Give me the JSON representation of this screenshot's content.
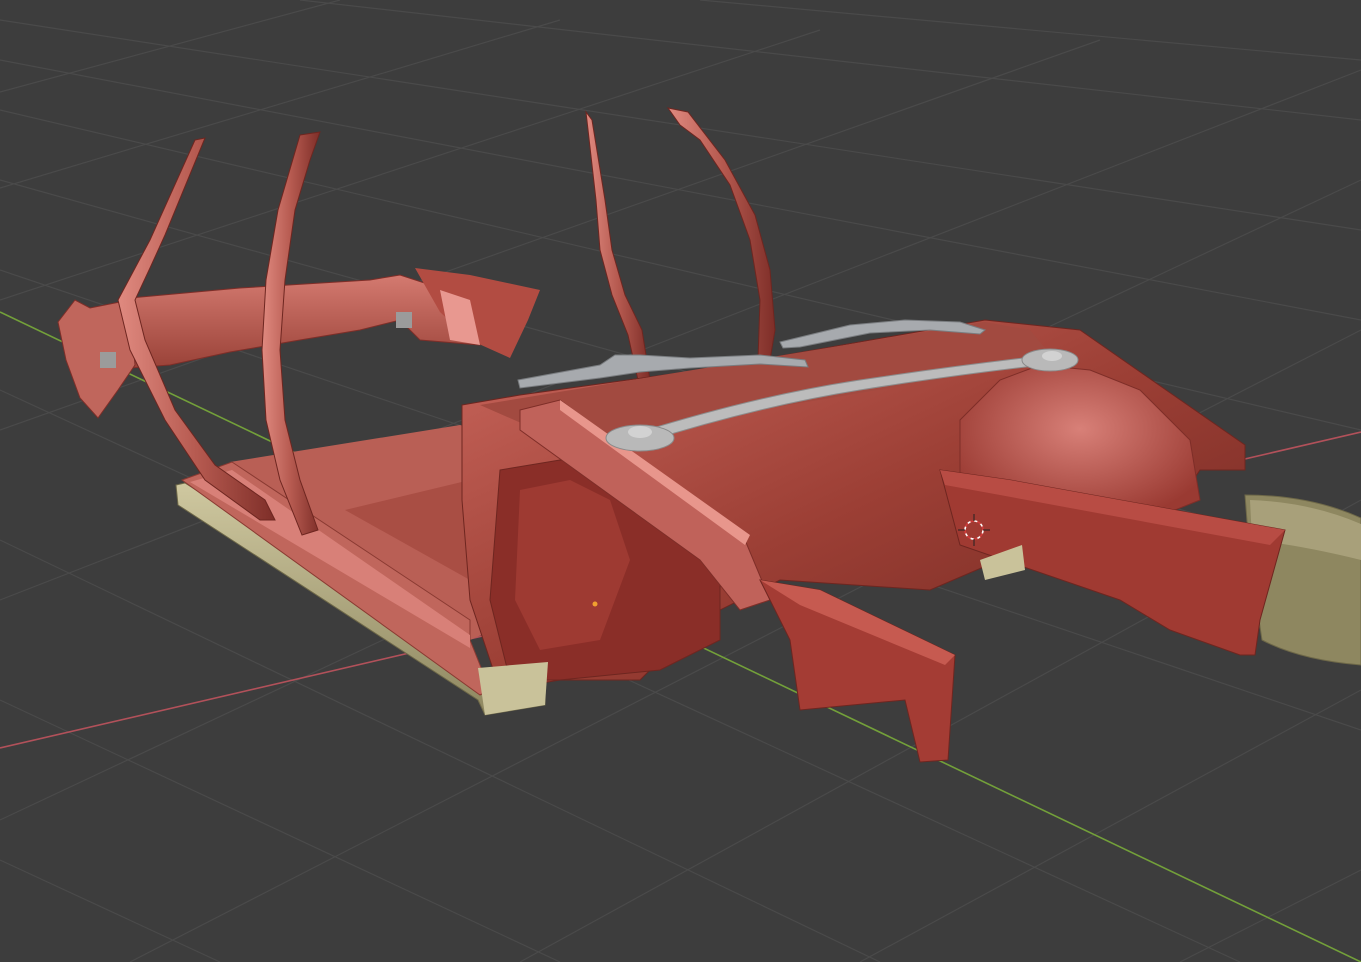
{
  "viewport": {
    "background_color": "#3d3d3d",
    "grid_line_color": "#4a4a4a",
    "x_axis_color": "#b2515a",
    "y_axis_color": "#73a03a"
  },
  "scene": {
    "body_color": "#a84a40",
    "body_highlight_color": "#d8807a",
    "body_shadow_color": "#6e2620",
    "rocker_color": "#b8b08a",
    "strut_bar_color": "#b9b9b9",
    "wiper_color": "#a7aaae",
    "cursor_icon": "3d-cursor-icon",
    "origin_icon": "object-origin-icon"
  }
}
